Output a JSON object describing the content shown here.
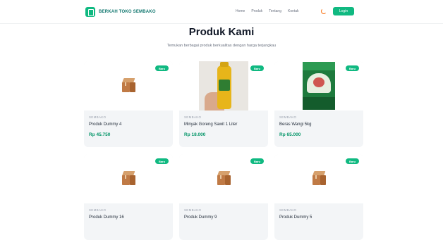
{
  "navbar": {
    "brand": "BERKAH TOKO SEMBAKO",
    "links": [
      "Home",
      "Produk",
      "Tentang",
      "Kontak"
    ],
    "cta_label": "Login",
    "colors": {
      "accent": "#10b981",
      "icon": "#f97316"
    }
  },
  "section": {
    "title": "Produk Kami",
    "subtitle": "Temukan berbagai produk berkualitas dengan harga terjangkau"
  },
  "products": [
    {
      "badge": "Baru",
      "category": "Sembako",
      "name": "Produk Dummy 4",
      "price": "Rp 45.750",
      "image": "box-icon"
    },
    {
      "badge": "Baru",
      "category": "Sembako",
      "name": "Minyak Goreng Sawit 1 Liter",
      "price": "Rp 18.000",
      "image": "oil-bottle"
    },
    {
      "badge": "Baru",
      "category": "Sembako",
      "name": "Beras Wangi 5kg",
      "price": "Rp 65.000",
      "image": "rice-bag"
    },
    {
      "badge": "Baru",
      "category": "Sembako",
      "name": "Produk Dummy 16",
      "price": "",
      "image": "box-icon"
    },
    {
      "badge": "Baru",
      "category": "Sembako",
      "name": "Produk Dummy 9",
      "price": "",
      "image": "box-icon"
    },
    {
      "badge": "Baru",
      "category": "Sembako",
      "name": "Produk Dummy 5",
      "price": "",
      "image": "box-icon"
    }
  ]
}
